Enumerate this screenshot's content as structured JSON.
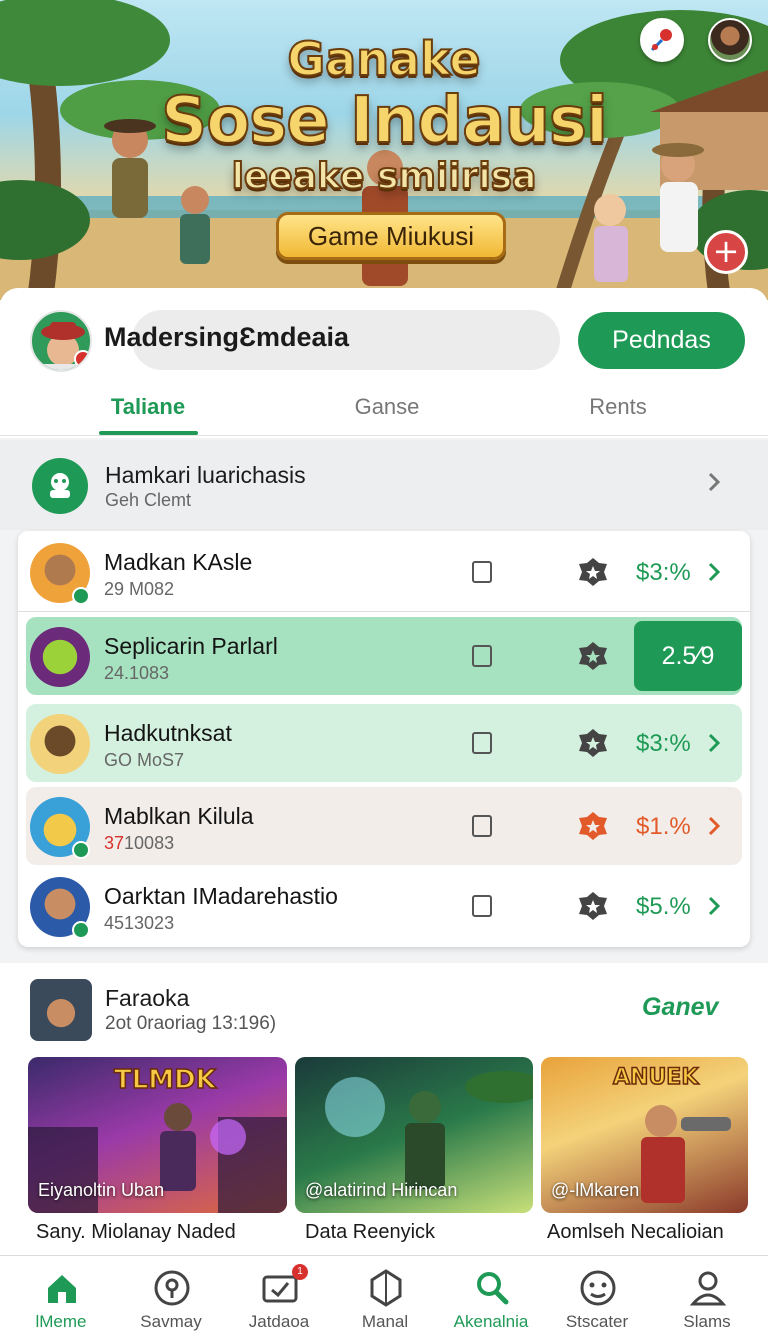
{
  "hero": {
    "title_line1": "Ganake",
    "title_line2": "Sose Indausi",
    "title_line3": "leeake smiirisa",
    "cta_label": "Game Miukusi",
    "pin_icon": "map-pin-icon",
    "avatar_icon": "profile-avatar-icon",
    "add_icon": "plus-icon"
  },
  "profile": {
    "name": "MadersingƐmdeaia",
    "primary_button": "Pedndas"
  },
  "tabs": [
    {
      "label": "Taliane",
      "active": true
    },
    {
      "label": "Ganse",
      "active": false
    },
    {
      "label": "Rents",
      "active": false
    }
  ],
  "section": {
    "title": "Hamkari luarichasis",
    "subtitle": "Geh Clemt"
  },
  "list": [
    {
      "title": "Madkan KAsle",
      "meta": "29 M082",
      "value": "$3:%",
      "state": "normal"
    },
    {
      "title": "Seplicarin Parlarl",
      "meta": "24.1083",
      "value": "2.5⁄9",
      "state": "selected"
    },
    {
      "title": "Hadkutnksat",
      "meta": "GO MoS7",
      "value": "$3:%",
      "state": "highlight"
    },
    {
      "title": "Mablkan Kilula",
      "meta_highlight": "37",
      "meta": "10083",
      "value": "$1.%",
      "state": "warning"
    },
    {
      "title": "Oarktan IMadarehastio",
      "meta": "4513023",
      "value": "$5.%",
      "state": "normal"
    }
  ],
  "featured": {
    "title": "Faraoka",
    "subtitle": "2ot 0raoriag 13:196)",
    "link": "Ganev",
    "cards": [
      {
        "logo": "TLMDK",
        "caption": "Eiyanoltin Uban",
        "label": "Sany. Miolanay Naded"
      },
      {
        "logo": "",
        "caption": "@alatirind Hirincan",
        "label": "Data Reenyick"
      },
      {
        "logo": "ANUEK",
        "caption": "@-lMkaren",
        "label": "Aomlseh Necalioian"
      }
    ]
  },
  "nav": [
    {
      "label": "lMeme",
      "icon": "home-icon",
      "active": true
    },
    {
      "label": "Savmay",
      "icon": "location-icon",
      "active": false
    },
    {
      "label": "Jatdaoa",
      "icon": "mail-icon",
      "active": false,
      "badge": "1"
    },
    {
      "label": "Manal",
      "icon": "shield-icon",
      "active": false
    },
    {
      "label": "Akenalnia",
      "icon": "search-icon",
      "active": true
    },
    {
      "label": "Stscater",
      "icon": "face-icon",
      "active": false
    },
    {
      "label": "Slams",
      "icon": "person-icon",
      "active": false
    }
  ],
  "colors": {
    "accent": "#1f9a56",
    "warning": "#e35a2a",
    "selected_row": "#a7e2c0",
    "highlight_row": "#d4f1df",
    "warning_row": "#f2ede9"
  }
}
